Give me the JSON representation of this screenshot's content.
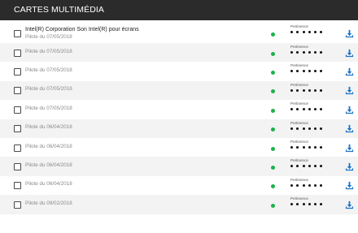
{
  "header": {
    "title": "CARTES MULTIMÉDIA"
  },
  "colors": {
    "status": "#1cb24b",
    "download": "#1a73c9",
    "header_bg": "#2b2b2b"
  },
  "rating_label": "Pertinence",
  "rows": [
    {
      "title": "Intel(R) Corporation Son Intel(R) pour écrans",
      "driver": "Pilote du 07/05/2018"
    },
    {
      "title": "",
      "driver": "Pilote du 07/05/2018"
    },
    {
      "title": "",
      "driver": "Pilote du 07/05/2018"
    },
    {
      "title": "",
      "driver": "Pilote du 07/05/2018"
    },
    {
      "title": "",
      "driver": "Pilote du 07/05/2018"
    },
    {
      "title": "",
      "driver": "Pilote du 06/04/2018"
    },
    {
      "title": "",
      "driver": "Pilote du 06/04/2018"
    },
    {
      "title": "",
      "driver": "Pilote du 06/04/2018"
    },
    {
      "title": "",
      "driver": "Pilote du 06/04/2018"
    },
    {
      "title": "",
      "driver": "Pilote du 09/02/2018"
    }
  ],
  "icons": {
    "status": "status-dot-icon",
    "download": "download-icon",
    "checkbox": "checkbox-icon"
  }
}
